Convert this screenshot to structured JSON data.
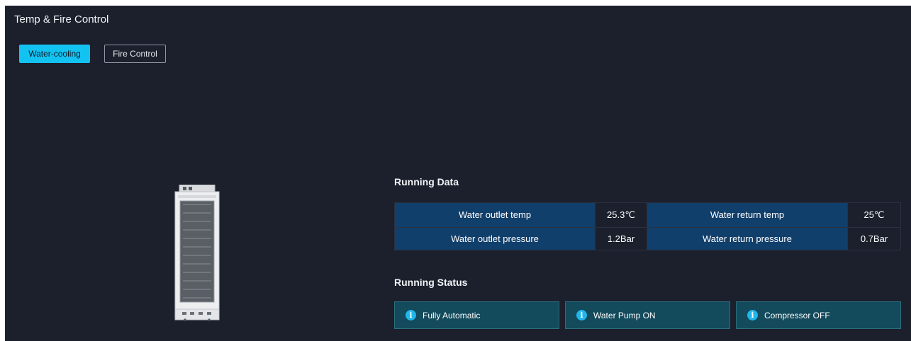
{
  "header": {
    "title": "Temp & Fire Control"
  },
  "tabs": [
    {
      "label": "Water-cooling",
      "active": true
    },
    {
      "label": "Fire Control",
      "active": false
    }
  ],
  "device": {
    "icon": "cooling-unit-illustration"
  },
  "running_data": {
    "title": "Running Data",
    "rows": [
      [
        {
          "label": "Water outlet temp",
          "value": "25.3℃"
        },
        {
          "label": "Water return temp",
          "value": "25℃"
        }
      ],
      [
        {
          "label": "Water outlet pressure",
          "value": "1.2Bar"
        },
        {
          "label": "Water return pressure",
          "value": "0.7Bar"
        }
      ]
    ]
  },
  "running_status": {
    "title": "Running Status",
    "items": [
      {
        "icon": "info-icon",
        "label": "Fully Automatic"
      },
      {
        "icon": "info-icon",
        "label": "Water Pump ON"
      },
      {
        "icon": "info-icon",
        "label": "Compressor OFF"
      }
    ]
  },
  "colors": {
    "panel_bg": "#1b202c",
    "accent": "#12c3f2",
    "table_label_bg": "#113f6b",
    "status_bg": "#134a5c"
  }
}
